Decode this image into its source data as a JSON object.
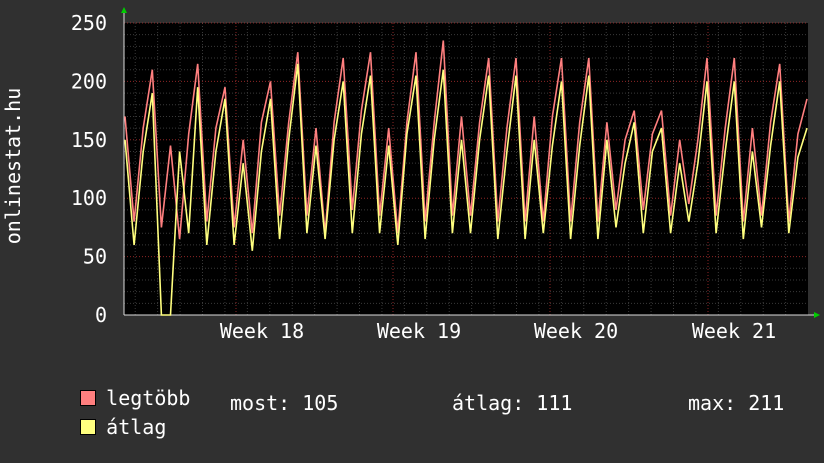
{
  "chart_data": {
    "type": "line",
    "ylabel": "onlinestat.hu",
    "ylim": [
      0,
      250
    ],
    "y_ticks": [
      "0",
      "50",
      "100",
      "150",
      "200",
      "250"
    ],
    "x_ticks": [
      "Week 18",
      "Week 19",
      "Week 20",
      "Week 21"
    ],
    "grid": true,
    "legend_placement": "bottom-left",
    "series": [
      {
        "name": "legtöbb",
        "color": "#ff7f7f",
        "values": [
          170,
          80,
          160,
          210,
          75,
          145,
          65,
          155,
          215,
          80,
          160,
          195,
          75,
          150,
          70,
          165,
          200,
          85,
          165,
          225,
          85,
          160,
          70,
          165,
          220,
          90,
          175,
          225,
          85,
          160,
          70,
          165,
          225,
          80,
          165,
          235,
          85,
          170,
          85,
          165,
          220,
          80,
          160,
          220,
          80,
          170,
          80,
          170,
          220,
          80,
          165,
          220,
          80,
          165,
          90,
          150,
          175,
          90,
          155,
          175,
          85,
          150,
          95,
          150,
          220,
          85,
          160,
          220,
          80,
          160,
          85,
          165,
          215,
          80,
          155,
          185
        ]
      },
      {
        "name": "átlag",
        "color": "#ffff7f",
        "values": [
          150,
          60,
          140,
          190,
          0,
          0,
          140,
          70,
          195,
          60,
          140,
          185,
          60,
          130,
          55,
          140,
          185,
          65,
          150,
          215,
          70,
          145,
          65,
          150,
          200,
          70,
          155,
          205,
          70,
          145,
          60,
          155,
          205,
          65,
          150,
          210,
          70,
          150,
          70,
          150,
          205,
          65,
          140,
          205,
          65,
          150,
          70,
          145,
          200,
          65,
          145,
          205,
          65,
          150,
          75,
          130,
          165,
          70,
          140,
          160,
          70,
          130,
          80,
          130,
          200,
          70,
          140,
          200,
          65,
          140,
          75,
          145,
          200,
          70,
          135,
          160
        ]
      }
    ]
  },
  "legend": [
    {
      "label": "legtöbb",
      "color": "#ff7f7f"
    },
    {
      "label": "átlag",
      "color": "#ffff7f"
    }
  ],
  "stats": {
    "most": "most: 105",
    "atlag": "átlag: 111",
    "max": "max: 211"
  }
}
